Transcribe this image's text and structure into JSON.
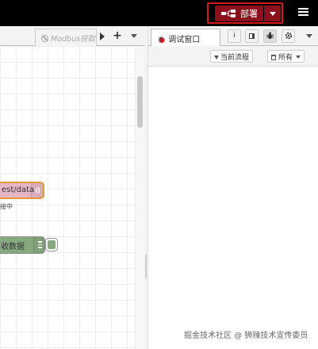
{
  "header": {
    "deploy_label": "部署",
    "colors": {
      "background": "#000000",
      "deploy": "#8c101c",
      "highlight": "#d11b1b"
    }
  },
  "workspace": {
    "tab_label": "Modbus获取设",
    "nodes": {
      "http_in_label": "est/data",
      "http_in_status": "接中",
      "debug_label": "收数据"
    }
  },
  "sidebar": {
    "tab_label": "调试窗口",
    "filter_label": "当前流程",
    "clear_label": "所有",
    "icons": [
      "info-icon",
      "book-icon",
      "bug-icon",
      "gear-icon"
    ]
  },
  "watermark": "掘金技术社区 @ 狮辣技术宣传委员"
}
